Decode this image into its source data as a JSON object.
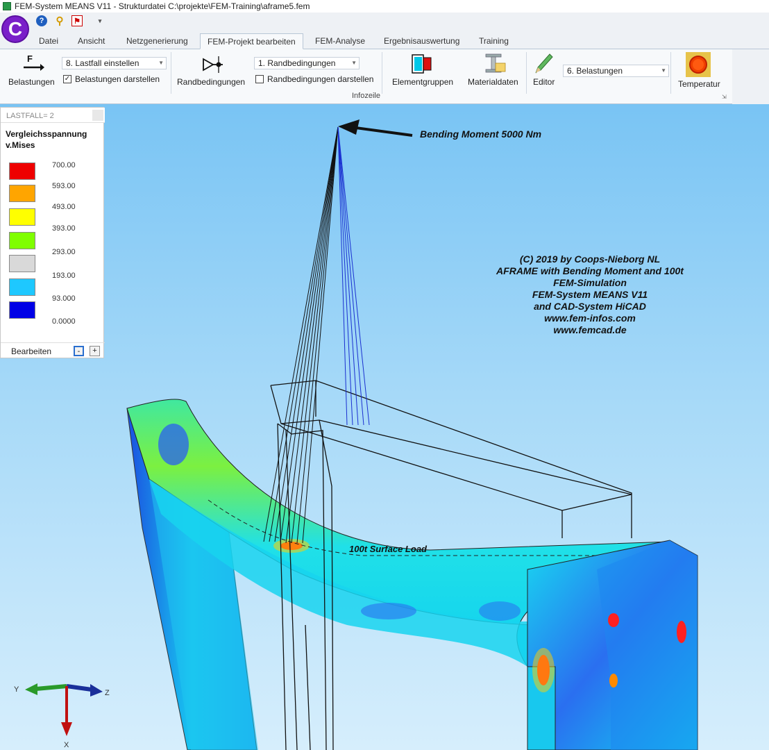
{
  "title_bar": {
    "text": "FEM-System MEANS V11 - Strukturdatei C:\\projekte\\FEM-Training\\aframe5.fem"
  },
  "logo": {
    "letter": "C",
    "icon": "app-logo-icon"
  },
  "quick_access": [
    "help-icon",
    "key-icon",
    "flag-icon"
  ],
  "tabs": [
    {
      "label": "Datei"
    },
    {
      "label": "Ansicht"
    },
    {
      "label": "Netzgenerierung"
    },
    {
      "label": "FEM-Projekt bearbeiten"
    },
    {
      "label": "FEM-Analyse"
    },
    {
      "label": "Ergebnisauswertung"
    },
    {
      "label": "Training"
    }
  ],
  "active_tab": "FEM-Projekt bearbeiten",
  "ribbon": {
    "belastungen": {
      "label": "Belastungen",
      "icon_text": "F"
    },
    "lastfall_select": {
      "value": "8.  Lastfall einstellen"
    },
    "belastungen_darstellen": {
      "label": "Belastungen darstellen",
      "checked": true,
      "check": "✓"
    },
    "randbedingungen": {
      "label": "Randbedingungen"
    },
    "randbed_select": {
      "value": "1.  Randbedingungen"
    },
    "randbed_darstellen": {
      "label": "Randbedingungen darstellen",
      "checked": false
    },
    "elementgruppen": {
      "label": "Elementgruppen"
    },
    "materialdaten": {
      "label": "Materialdaten"
    },
    "editor": {
      "label": "Editor"
    },
    "belastung_select": {
      "value": "6.  Belastungen"
    },
    "temperatur": {
      "label": "Temperatur"
    },
    "group_label": "Infozeile"
  },
  "legend": {
    "lastfall": "LASTFALL=  2",
    "title_line1": "Vergleichsspannung",
    "title_line2": "v.Mises",
    "entries": [
      {
        "value": "700.00",
        "color": "#ee0000"
      },
      {
        "value": "593.00",
        "color": "#ffa500"
      },
      {
        "value": "493.00",
        "color": "#ffff00"
      },
      {
        "value": "393.00",
        "color": "#7fff00"
      },
      {
        "value": "293.00",
        "color": "#d9d9d9"
      },
      {
        "value": "193.00",
        "color": "#1ec8ff"
      },
      {
        "value": "93.000",
        "color": "#0000e6"
      },
      {
        "value": "0.0000",
        "color": ""
      }
    ],
    "footer_label": "Bearbeiten",
    "minus": "-",
    "plus": "+"
  },
  "annotations": {
    "moment": "Bending Moment 5000 Nm",
    "surface_load": "100t Surface Load"
  },
  "copyright": [
    "(C) 2019 by Coops-Nieborg NL",
    "AFRAME with Bending  Moment and 100t",
    "FEM-Simulation",
    "FEM-System MEANS V11",
    "and CAD-System HiCAD",
    "www.fem-infos.com",
    "www.femcad.de"
  ],
  "axes": {
    "y": "Y",
    "z": "Z",
    "x": "X"
  }
}
